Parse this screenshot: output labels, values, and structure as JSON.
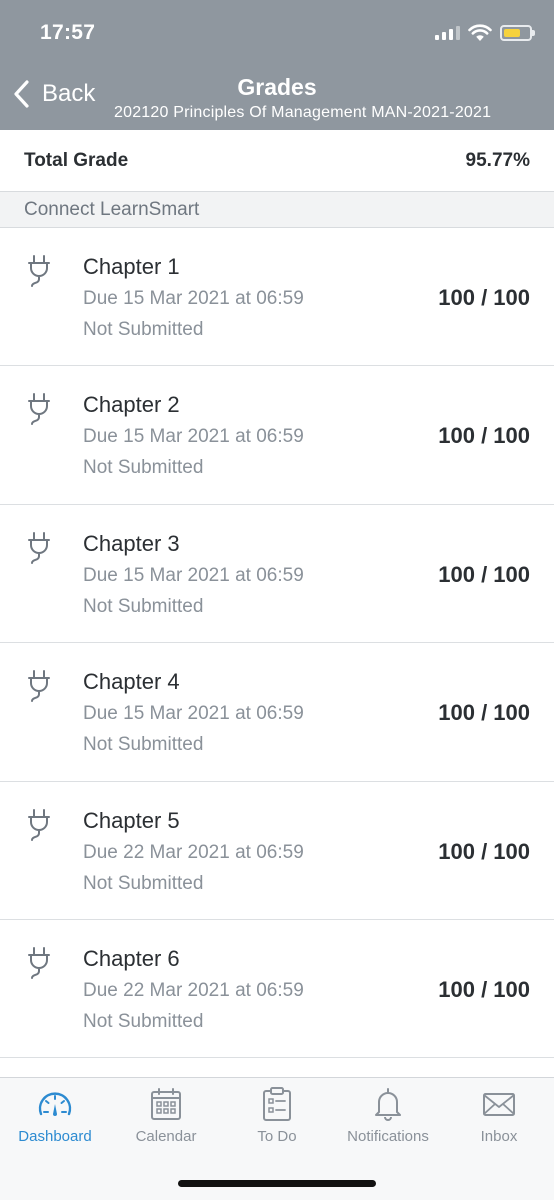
{
  "status_bar": {
    "time": "17:57"
  },
  "nav": {
    "back_label": "Back",
    "title": "Grades",
    "subtitle": "202120 Principles Of Management MAN-2021-2021"
  },
  "total": {
    "label": "Total Grade",
    "value": "95.77%"
  },
  "section": {
    "title": "Connect LearnSmart"
  },
  "items": [
    {
      "name": "Chapter 1",
      "due": "Due 15 Mar 2021 at 06:59",
      "status": "Not Submitted",
      "score": "100 / 100",
      "icon": "plug-icon"
    },
    {
      "name": "Chapter 2",
      "due": "Due 15 Mar 2021 at 06:59",
      "status": "Not Submitted",
      "score": "100 / 100",
      "icon": "plug-icon"
    },
    {
      "name": "Chapter 3",
      "due": "Due 15 Mar 2021 at 06:59",
      "status": "Not Submitted",
      "score": "100 / 100",
      "icon": "plug-icon"
    },
    {
      "name": "Chapter 4",
      "due": "Due 15 Mar 2021 at 06:59",
      "status": "Not Submitted",
      "score": "100 / 100",
      "icon": "plug-icon"
    },
    {
      "name": "Chapter 5",
      "due": "Due 22 Mar 2021 at 06:59",
      "status": "Not Submitted",
      "score": "100 / 100",
      "icon": "plug-icon"
    },
    {
      "name": "Chapter 6",
      "due": "Due 22 Mar 2021 at 06:59",
      "status": "Not Submitted",
      "score": "100 / 100",
      "icon": "plug-icon"
    }
  ],
  "tabs": [
    {
      "label": "Dashboard",
      "icon": "dashboard-gauge-icon",
      "active": true
    },
    {
      "label": "Calendar",
      "icon": "calendar-icon",
      "active": false
    },
    {
      "label": "To Do",
      "icon": "todo-clipboard-icon",
      "active": false
    },
    {
      "label": "Notifications",
      "icon": "bell-icon",
      "active": false
    },
    {
      "label": "Inbox",
      "icon": "envelope-icon",
      "active": false
    }
  ],
  "colors": {
    "header_bg": "#8f979f",
    "accent": "#2d8bd1",
    "muted_text": "#8a9199",
    "battery": "#f6d23c"
  }
}
